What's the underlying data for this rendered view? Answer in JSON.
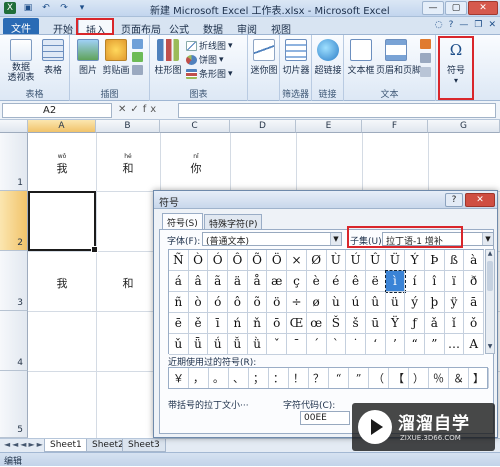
{
  "window": {
    "title": "新建 Microsoft Excel 工作表.xlsx - Microsoft Excel"
  },
  "tabs": [
    "文件",
    "开始",
    "插入",
    "页面布局",
    "公式",
    "数据",
    "审阅",
    "视图"
  ],
  "ribbon": {
    "groups": {
      "tables": "表格",
      "illustrations": "插图",
      "charts": "图表",
      "filter": "筛选器",
      "links": "链接",
      "text": "文本"
    },
    "buttons": {
      "pivot": "数据\n透视表",
      "table": "表格",
      "picture": "图片",
      "clipart": "剪贴画",
      "column_chart": "柱形图",
      "line_chart": "折线图",
      "pie_chart": "饼图",
      "bar_chart": "条形图",
      "sparkline": "迷你图",
      "slicer": "切片器",
      "hyperlink": "超链接",
      "textbox": "文本框",
      "header_footer": "页眉和页脚",
      "symbol": "符号",
      "symbol_glyph": "Ω"
    }
  },
  "formula_bar": {
    "name_box": "A2",
    "fx": "✕✓fx"
  },
  "grid": {
    "columns": [
      "A",
      "B",
      "C",
      "D",
      "E",
      "F",
      "G"
    ],
    "rows": [
      "1",
      "2",
      "3",
      "4",
      "5"
    ],
    "cells": {
      "a1": {
        "pinyin": "wǒ",
        "char": "我"
      },
      "b1": {
        "pinyin": "hé",
        "char": "和"
      },
      "c1": {
        "pinyin": "nǐ",
        "char": "你"
      },
      "a3": "我",
      "b3": "和"
    }
  },
  "sheets": [
    "Sheet1",
    "Sheet2",
    "Sheet3"
  ],
  "status": "编辑",
  "dialog": {
    "title": "符号",
    "tabs": [
      "符号(S)",
      "特殊字符(P)"
    ],
    "font_label": "字体(F):",
    "font_value": "(普通文本)",
    "subset_label": "子集(U):",
    "subset_value": "拉丁语-1 增补",
    "symbols": [
      "Ñ",
      "Ò",
      "Ó",
      "Ô",
      "Õ",
      "Ö",
      "×",
      "Ø",
      "Ù",
      "Ú",
      "Û",
      "Ü",
      "Ý",
      "Þ",
      "ß",
      "à",
      "á",
      "â",
      "ã",
      "ä",
      "å",
      "æ",
      "ç",
      "è",
      "é",
      "ê",
      "ë",
      "ì",
      "í",
      "î",
      "ï",
      "ð",
      "ñ",
      "ò",
      "ó",
      "ô",
      "õ",
      "ö",
      "÷",
      "ø",
      "ù",
      "ú",
      "û",
      "ü",
      "ý",
      "þ",
      "ÿ",
      "ā",
      "ē",
      "ě",
      "ī",
      "ń",
      "ň",
      "ō",
      "Œ",
      "œ",
      "Š",
      "š",
      "ū",
      "Ÿ",
      "ƒ",
      "ǎ",
      "ǐ",
      "ǒ",
      "ǔ",
      "ǖ",
      "ǘ",
      "ǚ",
      "ǜ",
      "ˇ",
      "ˉ",
      "ˊ",
      "ˋ",
      "˙",
      "‘",
      "’",
      "“",
      "”",
      "…",
      "A"
    ],
    "selected_index": 27,
    "recent_label": "近期使用过的符号(R):",
    "recent": [
      "￥",
      "，",
      "。",
      "、",
      "；",
      "：",
      "！",
      "？",
      "“",
      "”",
      "（",
      "【",
      "）",
      "％",
      "＆",
      "】"
    ],
    "charname_label": "带括号的拉丁文小···",
    "charcode_label": "字符代码(C):",
    "charcode_value": "00EE"
  },
  "watermark": {
    "title": "溜溜自学",
    "url": "ZIXUE.3D66.COM"
  }
}
